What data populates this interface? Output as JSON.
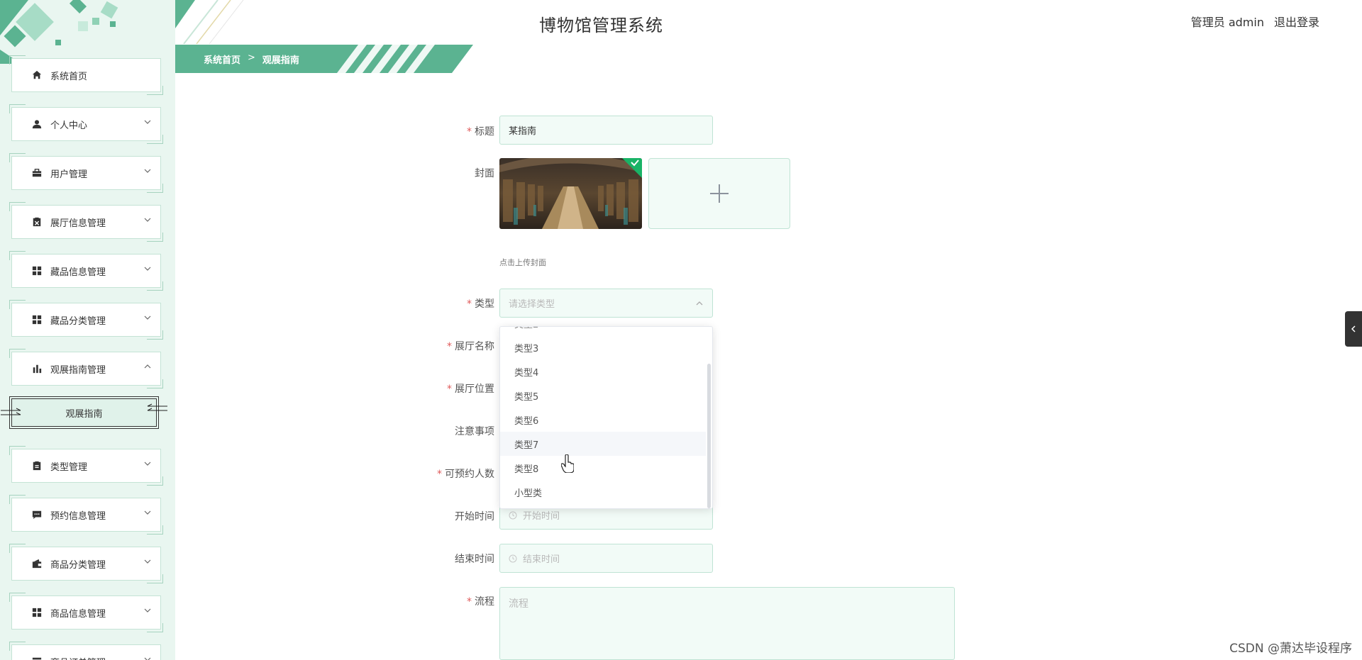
{
  "app": {
    "title": "博物馆管理系统",
    "user_label": "管理员 admin",
    "logout_label": "退出登录"
  },
  "breadcrumb": {
    "home": "系统首页",
    "separator": ">",
    "current": "观展指南"
  },
  "sidebar": {
    "items": [
      {
        "label": "系统首页",
        "icon": "home-icon",
        "expandable": false
      },
      {
        "label": "个人中心",
        "icon": "user-icon",
        "expandable": true
      },
      {
        "label": "用户管理",
        "icon": "briefcase-icon",
        "expandable": true
      },
      {
        "label": "展厅信息管理",
        "icon": "clipboard-x-icon",
        "expandable": true
      },
      {
        "label": "藏品信息管理",
        "icon": "grid-icon",
        "expandable": true
      },
      {
        "label": "藏品分类管理",
        "icon": "grid-icon",
        "expandable": true
      },
      {
        "label": "观展指南管理",
        "icon": "bar-chart-icon",
        "expandable": true,
        "expanded": true
      },
      {
        "label": "类型管理",
        "icon": "clipboard-icon",
        "expandable": true
      },
      {
        "label": "预约信息管理",
        "icon": "chat-icon",
        "expandable": true
      },
      {
        "label": "商品分类管理",
        "icon": "wallet-icon",
        "expandable": true
      },
      {
        "label": "商品信息管理",
        "icon": "grid-icon",
        "expandable": true
      },
      {
        "label": "商品订单管理",
        "icon": "list-icon",
        "expandable": true
      }
    ],
    "sub_item": {
      "label": "观展指南",
      "active": true
    }
  },
  "form": {
    "title": {
      "label": "标题",
      "required": true,
      "value": "某指南"
    },
    "cover": {
      "label": "封面",
      "hint": "点击上传封面"
    },
    "type": {
      "label": "类型",
      "required": true,
      "placeholder": "请选择类型"
    },
    "hall_name": {
      "label": "展厅名称",
      "required": true
    },
    "hall_location": {
      "label": "展厅位置",
      "required": true
    },
    "notes": {
      "label": "注意事项",
      "required": false
    },
    "capacity": {
      "label": "可预约人数",
      "required": true
    },
    "start_time": {
      "label": "开始时间",
      "required": false,
      "placeholder": "开始时间"
    },
    "end_time": {
      "label": "结束时间",
      "required": false,
      "placeholder": "结束时间"
    },
    "process": {
      "label": "流程",
      "required": true,
      "placeholder": "流程"
    }
  },
  "dropdown": {
    "options": [
      "类型3",
      "类型4",
      "类型5",
      "类型6",
      "类型7",
      "类型8",
      "小型类"
    ],
    "hovered": "类型7"
  },
  "watermark": "CSDN @萧达毕设程序",
  "colors": {
    "accent": "#5bb391",
    "sidebar_bg": "#e9f6f0",
    "input_bg": "#f2fbf7",
    "input_border": "#bfe3d4",
    "required": "#e05a5a"
  }
}
